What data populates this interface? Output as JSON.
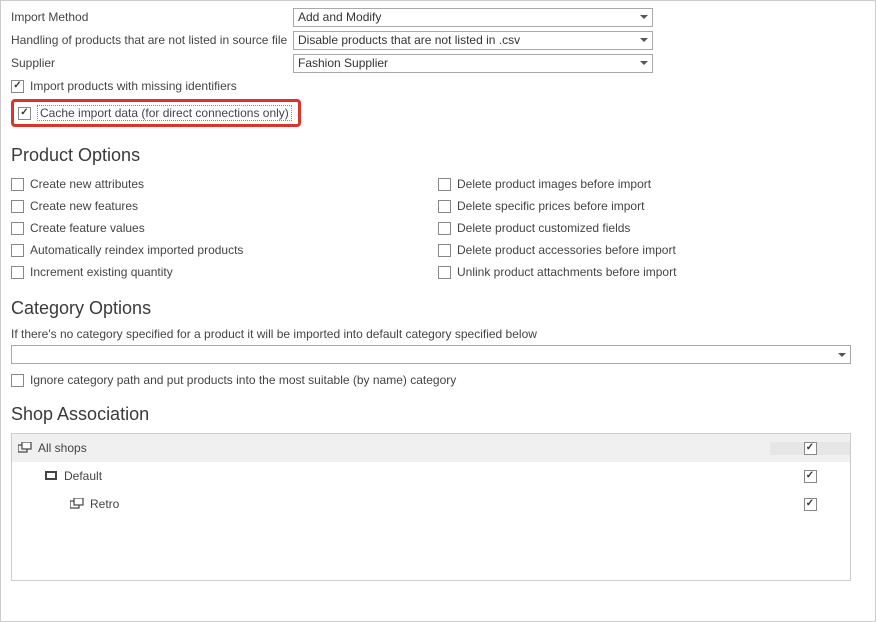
{
  "form": {
    "import_method": {
      "label": "Import Method",
      "value": "Add and Modify"
    },
    "handling": {
      "label": "Handling of products that are not listed in source file",
      "value": "Disable products that are not listed in .csv"
    },
    "supplier": {
      "label": "Supplier",
      "value": "Fashion Supplier"
    },
    "import_missing": {
      "label": "Import products with missing identifiers",
      "checked": true
    },
    "cache_import": {
      "label": "Cache import data (for direct connections only)",
      "checked": true
    }
  },
  "sections": {
    "product_options": "Product Options",
    "category_options": "Category Options",
    "shop_association": "Shop Association"
  },
  "product_options": {
    "left": [
      {
        "label": "Create new attributes",
        "checked": false
      },
      {
        "label": "Create new features",
        "checked": false
      },
      {
        "label": "Create feature values",
        "checked": false
      },
      {
        "label": "Automatically reindex imported products",
        "checked": false
      },
      {
        "label": "Increment existing quantity",
        "checked": false
      }
    ],
    "right": [
      {
        "label": "Delete product images before import",
        "checked": false
      },
      {
        "label": "Delete specific prices before import",
        "checked": false
      },
      {
        "label": "Delete product customized fields",
        "checked": false
      },
      {
        "label": "Delete product accessories before import",
        "checked": false
      },
      {
        "label": "Unlink product attachments before import",
        "checked": false
      }
    ]
  },
  "category": {
    "help": "If there's no category specified for a product it will be imported into default category specified below",
    "value": "",
    "ignore_path": {
      "label": "Ignore category path and put products into the most suitable (by name) category",
      "checked": false
    }
  },
  "shops": {
    "rows": [
      {
        "label": "All shops",
        "indent": 0,
        "checked": true
      },
      {
        "label": "Default",
        "indent": 1,
        "checked": true
      },
      {
        "label": "Retro",
        "indent": 2,
        "checked": true
      }
    ]
  }
}
